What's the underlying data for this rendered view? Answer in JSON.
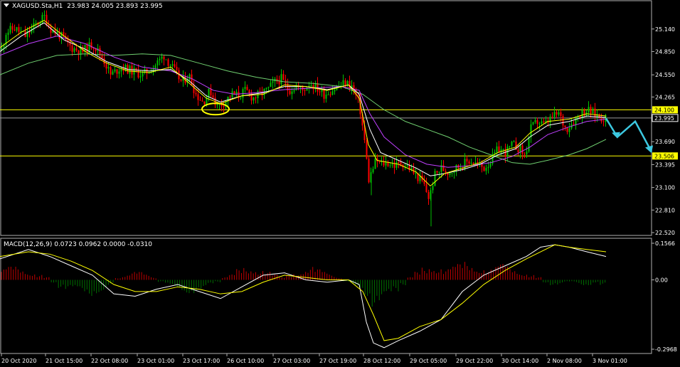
{
  "header": {
    "symbol": "XAGUSD.Sta,H1",
    "ohlc": "23.983 24.005 23.893 23.995",
    "macd_label": "MACD(12,26,9) 0.0723 0.0962 0.0000 -0.0310"
  },
  "colors": {
    "background": "#000000",
    "bull_candle": "#00C000",
    "bear_candle": "#FF0000",
    "ma_fast": "#FFFF00",
    "ma_white": "#FFFFFF",
    "ma_mid": "#C040FF",
    "ma_slow": "#70D070",
    "level_line": "#FFFF00",
    "arrow": "#3CC8E0",
    "macd_pos": "#C00000",
    "macd_neg": "#007000",
    "macd_line": "#FFFFFF",
    "signal_line": "#FFFF00"
  },
  "chart_data": [
    {
      "type": "candlestick",
      "ylim": [
        22.52,
        25.33
      ],
      "y_ticks": [
        "25.140",
        "24.850",
        "24.550",
        "24.265",
        "23.980",
        "23.690",
        "23.395",
        "23.100",
        "22.810",
        "22.520"
      ],
      "price_levels": [
        {
          "value": 24.1,
          "label": "24.100",
          "style": "box"
        },
        {
          "value": 23.506,
          "label": "23.506",
          "style": "box"
        }
      ],
      "current_price": {
        "value": 23.995,
        "label": "23.995"
      },
      "x_labels": [
        "20 Oct 2020",
        "21 Oct 15:00",
        "22 Oct 08:00",
        "23 Oct 01:00",
        "23 Oct 17:00",
        "26 Oct 10:00",
        "27 Oct 03:00",
        "27 Oct 19:00",
        "28 Oct 12:00",
        "29 Oct 05:00",
        "29 Oct 22:00",
        "30 Oct 14:00",
        "2 Nov 08:00",
        "3 Nov 01:00"
      ],
      "close_path": [
        [
          0,
          24.8
        ],
        [
          8,
          25.1
        ],
        [
          20,
          25.15
        ],
        [
          35,
          25.05
        ],
        [
          50,
          25.2
        ],
        [
          62,
          25.3
        ],
        [
          70,
          25.15
        ],
        [
          85,
          25.05
        ],
        [
          100,
          24.9
        ],
        [
          115,
          24.85
        ],
        [
          130,
          24.95
        ],
        [
          145,
          24.75
        ],
        [
          155,
          24.55
        ],
        [
          170,
          24.65
        ],
        [
          185,
          24.6
        ],
        [
          200,
          24.55
        ],
        [
          215,
          24.65
        ],
        [
          230,
          24.8
        ],
        [
          245,
          24.6
        ],
        [
          255,
          24.45
        ],
        [
          265,
          24.55
        ],
        [
          275,
          24.3
        ],
        [
          285,
          24.2
        ],
        [
          295,
          24.35
        ],
        [
          305,
          24.15
        ],
        [
          315,
          24.2
        ],
        [
          325,
          24.3
        ],
        [
          335,
          24.28
        ],
        [
          345,
          24.35
        ],
        [
          355,
          24.25
        ],
        [
          365,
          24.3
        ],
        [
          375,
          24.35
        ],
        [
          385,
          24.45
        ],
        [
          395,
          24.5
        ],
        [
          405,
          24.35
        ],
        [
          415,
          24.4
        ],
        [
          425,
          24.35
        ],
        [
          435,
          24.45
        ],
        [
          445,
          24.38
        ],
        [
          455,
          24.3
        ],
        [
          465,
          24.35
        ],
        [
          475,
          24.4
        ],
        [
          485,
          24.45
        ],
        [
          495,
          24.4
        ],
        [
          505,
          24.15
        ],
        [
          512,
          23.7
        ],
        [
          518,
          23.2
        ],
        [
          522,
          23.3
        ],
        [
          528,
          23.45
        ],
        [
          535,
          23.4
        ],
        [
          545,
          23.42
        ],
        [
          555,
          23.38
        ],
        [
          565,
          23.42
        ],
        [
          575,
          23.35
        ],
        [
          585,
          23.25
        ],
        [
          595,
          23.15
        ],
        [
          603,
          22.95
        ],
        [
          610,
          23.25
        ],
        [
          620,
          23.35
        ],
        [
          630,
          23.3
        ],
        [
          640,
          23.35
        ],
        [
          650,
          23.4
        ],
        [
          660,
          23.45
        ],
        [
          670,
          23.4
        ],
        [
          680,
          23.35
        ],
        [
          690,
          23.45
        ],
        [
          700,
          23.6
        ],
        [
          710,
          23.55
        ],
        [
          720,
          23.65
        ],
        [
          730,
          23.6
        ],
        [
          738,
          23.5
        ],
        [
          745,
          23.85
        ],
        [
          755,
          23.95
        ],
        [
          765,
          23.9
        ],
        [
          775,
          24.0
        ],
        [
          785,
          24.05
        ],
        [
          795,
          23.85
        ],
        [
          805,
          23.95
        ],
        [
          815,
          24.05
        ],
        [
          825,
          24.1
        ],
        [
          835,
          24.05
        ],
        [
          845,
          24.0
        ],
        [
          852,
          23.99
        ]
      ],
      "ma_fast": [
        [
          0,
          24.9
        ],
        [
          30,
          25.1
        ],
        [
          62,
          25.25
        ],
        [
          90,
          25.05
        ],
        [
          120,
          24.85
        ],
        [
          150,
          24.7
        ],
        [
          180,
          24.6
        ],
        [
          210,
          24.58
        ],
        [
          240,
          24.65
        ],
        [
          265,
          24.45
        ],
        [
          290,
          24.25
        ],
        [
          310,
          24.18
        ],
        [
          340,
          24.28
        ],
        [
          370,
          24.3
        ],
        [
          400,
          24.42
        ],
        [
          430,
          24.4
        ],
        [
          460,
          24.35
        ],
        [
          490,
          24.42
        ],
        [
          505,
          24.25
        ],
        [
          518,
          23.65
        ],
        [
          530,
          23.45
        ],
        [
          560,
          23.4
        ],
        [
          585,
          23.3
        ],
        [
          605,
          23.12
        ],
        [
          625,
          23.28
        ],
        [
          650,
          23.35
        ],
        [
          675,
          23.42
        ],
        [
          700,
          23.55
        ],
        [
          725,
          23.62
        ],
        [
          745,
          23.8
        ],
        [
          770,
          23.95
        ],
        [
          800,
          23.98
        ],
        [
          825,
          24.05
        ],
        [
          852,
          24.02
        ]
      ],
      "ma_white": [
        [
          0,
          24.85
        ],
        [
          30,
          25.05
        ],
        [
          62,
          25.22
        ],
        [
          90,
          25.0
        ],
        [
          120,
          24.88
        ],
        [
          150,
          24.72
        ],
        [
          180,
          24.62
        ],
        [
          210,
          24.6
        ],
        [
          240,
          24.62
        ],
        [
          265,
          24.48
        ],
        [
          290,
          24.28
        ],
        [
          310,
          24.2
        ],
        [
          340,
          24.28
        ],
        [
          370,
          24.32
        ],
        [
          400,
          24.4
        ],
        [
          430,
          24.4
        ],
        [
          460,
          24.36
        ],
        [
          490,
          24.42
        ],
        [
          505,
          24.3
        ],
        [
          520,
          23.85
        ],
        [
          535,
          23.55
        ],
        [
          560,
          23.45
        ],
        [
          585,
          23.35
        ],
        [
          605,
          23.25
        ],
        [
          625,
          23.28
        ],
        [
          650,
          23.33
        ],
        [
          675,
          23.4
        ],
        [
          700,
          23.52
        ],
        [
          725,
          23.6
        ],
        [
          745,
          23.75
        ],
        [
          770,
          23.9
        ],
        [
          800,
          23.95
        ],
        [
          825,
          24.02
        ],
        [
          852,
          24.0
        ]
      ],
      "ma_mid": [
        [
          0,
          24.8
        ],
        [
          40,
          24.95
        ],
        [
          80,
          25.05
        ],
        [
          120,
          24.95
        ],
        [
          160,
          24.78
        ],
        [
          200,
          24.65
        ],
        [
          240,
          24.6
        ],
        [
          270,
          24.5
        ],
        [
          300,
          24.35
        ],
        [
          330,
          24.3
        ],
        [
          360,
          24.32
        ],
        [
          400,
          24.36
        ],
        [
          440,
          24.38
        ],
        [
          480,
          24.4
        ],
        [
          505,
          24.35
        ],
        [
          520,
          24.05
        ],
        [
          540,
          23.75
        ],
        [
          570,
          23.52
        ],
        [
          600,
          23.4
        ],
        [
          630,
          23.36
        ],
        [
          660,
          23.38
        ],
        [
          690,
          23.42
        ],
        [
          720,
          23.5
        ],
        [
          745,
          23.62
        ],
        [
          770,
          23.78
        ],
        [
          800,
          23.88
        ],
        [
          825,
          23.95
        ],
        [
          852,
          23.98
        ]
      ],
      "ma_slow": [
        [
          0,
          24.55
        ],
        [
          40,
          24.7
        ],
        [
          80,
          24.8
        ],
        [
          120,
          24.82
        ],
        [
          160,
          24.8
        ],
        [
          200,
          24.82
        ],
        [
          240,
          24.8
        ],
        [
          280,
          24.7
        ],
        [
          320,
          24.6
        ],
        [
          360,
          24.52
        ],
        [
          400,
          24.46
        ],
        [
          440,
          24.44
        ],
        [
          480,
          24.4
        ],
        [
          510,
          24.3
        ],
        [
          540,
          24.1
        ],
        [
          570,
          23.95
        ],
        [
          600,
          23.85
        ],
        [
          630,
          23.75
        ],
        [
          660,
          23.62
        ],
        [
          690,
          23.52
        ],
        [
          720,
          23.42
        ],
        [
          745,
          23.4
        ],
        [
          770,
          23.45
        ],
        [
          800,
          23.52
        ],
        [
          825,
          23.6
        ],
        [
          852,
          23.72
        ]
      ],
      "forecast_arrow": [
        [
          852,
          23.99
        ],
        [
          868,
          23.75
        ],
        [
          893,
          23.95
        ],
        [
          916,
          23.56
        ]
      ],
      "highlight_ellipse": {
        "x": 303,
        "y": 24.11
      }
    },
    {
      "type": "macd",
      "ylim": [
        -0.2968,
        0.1566
      ],
      "y_ticks": [
        "0.1566",
        "0.00",
        "-0.2968"
      ],
      "histogram": [
        0.04,
        0.05,
        0.05,
        0.04,
        0.03,
        0.02,
        0.01,
        -0.01,
        -0.03,
        -0.04,
        -0.04,
        -0.05,
        -0.06,
        -0.05,
        -0.04,
        -0.02,
        0.01,
        0.02,
        0.03,
        0.03,
        0.02,
        0.01,
        -0.01,
        -0.02,
        -0.03,
        -0.04,
        -0.05,
        -0.05,
        -0.04,
        -0.02,
        -0.01,
        0.01,
        0.02,
        0.04,
        0.05,
        0.05,
        0.04,
        0.03,
        0.02,
        0.01,
        0.02,
        0.03,
        0.04,
        0.05,
        0.04,
        0.03,
        0.02,
        0.01,
        -0.01,
        -0.02,
        -0.03,
        -0.06,
        -0.1,
        -0.09,
        -0.07,
        -0.05,
        -0.02,
        0.01,
        0.03,
        0.05,
        0.06,
        0.05,
        0.04,
        0.05,
        0.06,
        0.07,
        0.06,
        0.05,
        0.04,
        0.05,
        0.06,
        0.05,
        0.04,
        0.03,
        0.02,
        0.01,
        -0.01,
        -0.02,
        -0.02,
        -0.01,
        -0.01,
        -0.02,
        -0.02,
        -0.01,
        -0.02
      ],
      "macd": [
        [
          0,
          0.09
        ],
        [
          40,
          0.13
        ],
        [
          70,
          0.1
        ],
        [
          100,
          0.06
        ],
        [
          130,
          0.02
        ],
        [
          160,
          -0.06
        ],
        [
          190,
          -0.07
        ],
        [
          220,
          -0.04
        ],
        [
          250,
          -0.02
        ],
        [
          280,
          -0.05
        ],
        [
          310,
          -0.08
        ],
        [
          340,
          -0.03
        ],
        [
          370,
          0.02
        ],
        [
          400,
          0.03
        ],
        [
          430,
          0.0
        ],
        [
          460,
          -0.01
        ],
        [
          490,
          0.0
        ],
        [
          505,
          -0.02
        ],
        [
          515,
          -0.18
        ],
        [
          525,
          -0.27
        ],
        [
          540,
          -0.29
        ],
        [
          560,
          -0.26
        ],
        [
          590,
          -0.22
        ],
        [
          620,
          -0.17
        ],
        [
          650,
          -0.05
        ],
        [
          680,
          0.02
        ],
        [
          710,
          0.06
        ],
        [
          740,
          0.1
        ],
        [
          760,
          0.14
        ],
        [
          780,
          0.15
        ],
        [
          800,
          0.14
        ],
        [
          825,
          0.12
        ],
        [
          852,
          0.1
        ]
      ],
      "signal": [
        [
          0,
          0.1
        ],
        [
          40,
          0.12
        ],
        [
          70,
          0.11
        ],
        [
          100,
          0.08
        ],
        [
          130,
          0.04
        ],
        [
          160,
          -0.02
        ],
        [
          190,
          -0.05
        ],
        [
          220,
          -0.05
        ],
        [
          250,
          -0.03
        ],
        [
          280,
          -0.04
        ],
        [
          310,
          -0.06
        ],
        [
          340,
          -0.05
        ],
        [
          370,
          -0.01
        ],
        [
          400,
          0.02
        ],
        [
          430,
          0.01
        ],
        [
          460,
          0.0
        ],
        [
          490,
          0.0
        ],
        [
          510,
          -0.05
        ],
        [
          525,
          -0.15
        ],
        [
          540,
          -0.26
        ],
        [
          560,
          -0.25
        ],
        [
          590,
          -0.2
        ],
        [
          620,
          -0.17
        ],
        [
          650,
          -0.1
        ],
        [
          680,
          -0.02
        ],
        [
          710,
          0.04
        ],
        [
          740,
          0.09
        ],
        [
          760,
          0.12
        ],
        [
          780,
          0.15
        ],
        [
          800,
          0.14
        ],
        [
          825,
          0.13
        ],
        [
          852,
          0.12
        ]
      ]
    }
  ]
}
